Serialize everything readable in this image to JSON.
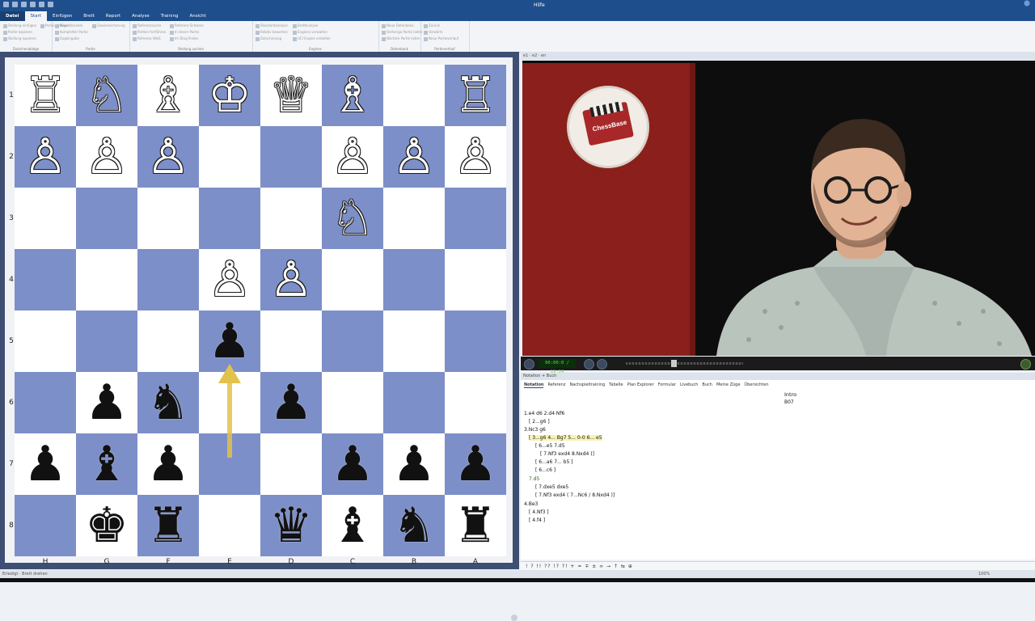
{
  "window": {
    "title": "Hilfe"
  },
  "menu": {
    "tabs": [
      "Datei",
      "Start",
      "Einfügen",
      "Brett",
      "Report",
      "Analyse",
      "Training",
      "Ansicht"
    ],
    "active": "Start"
  },
  "ribbon": {
    "groups": [
      {
        "name": "Zwischenablage",
        "items": [
          "Stellung einfügen",
          "Partie kopieren",
          "Stellung kopieren",
          "Partie einfügen"
        ]
      },
      {
        "name": "Partie",
        "items": [
          "Neue Variante",
          "Kompletter Partie",
          "Zugeingabe",
          "Gewinnsicherung"
        ]
      },
      {
        "name": "Stellung suchen",
        "items": [
          "Referenzsuche",
          "Partien fortführen",
          "Referenz Weiß",
          "Referenz Schwarz",
          "In dieser Partie",
          "Im Ding finden"
        ]
      },
      {
        "name": "Engines",
        "items": [
          "Standardanalyse",
          "Relativ bewerten",
          "Zwischenzug",
          "Brettanalyse",
          "Engines verwalten",
          "UCI Engine erstellen"
        ]
      },
      {
        "name": "Datenbank",
        "items": [
          "Neue Datenbank",
          "Vorherige Partie laden",
          "Nächste Partie laden"
        ]
      },
      {
        "name": "Partieverlauf",
        "items": [
          "Zurück",
          "Vorwärts",
          "Neue Partieverlauf"
        ]
      }
    ]
  },
  "board": {
    "files": [
      "H",
      "G",
      "F",
      "E",
      "D",
      "C",
      "B",
      "A"
    ],
    "ranks": [
      "1",
      "2",
      "3",
      "4",
      "5",
      "6",
      "7",
      "8"
    ],
    "squares": [
      [
        "R",
        "N",
        "B",
        "K",
        "Q",
        "B",
        "",
        "R"
      ],
      [
        "P",
        "P",
        "P",
        "",
        "",
        "P",
        "P",
        "P"
      ],
      [
        "",
        "",
        "",
        "",
        "",
        "N",
        "",
        ""
      ],
      [
        "",
        "",
        "",
        "P",
        "P",
        "",
        "",
        ""
      ],
      [
        "",
        "",
        "",
        "p",
        "",
        "",
        "",
        ""
      ],
      [
        "",
        "p",
        "n",
        "",
        "p",
        "",
        "",
        ""
      ],
      [
        "p",
        "b",
        "p",
        "",
        "",
        "p",
        "p",
        "p"
      ],
      [
        "",
        "k",
        "r",
        "",
        "q",
        "b",
        "n",
        "r"
      ]
    ],
    "arrow": {
      "from": "E7",
      "to": "E5",
      "color": "#e2c24a"
    }
  },
  "video": {
    "panel_title": "e1 · e2 · en",
    "logo_text": "ChessBase",
    "time": "00:00:0 / 19:54"
  },
  "notation": {
    "panel_title": "Notation + Buch",
    "tabs": [
      "Notation",
      "Referenz",
      "Nachspieltraining",
      "Tabelle",
      "Plan Explorer",
      "Formular",
      "Livebuch",
      "Buch",
      "Meine Züge",
      "Übersichten"
    ],
    "heading": "Intro",
    "eco": "B07",
    "lines": [
      "1.e4  d6  2.d4  Nf6",
      "[ 2...g6 ]",
      "3.Nc3  g6",
      "[ 3...g6  4... Bg7  5... 0-0  6... e5",
      "[ 6...e5  7.d5",
      "[ 7.Nf3  exd4  8.Nxd4 )]",
      "[ 6...a6  7... b5 ]",
      "[ 6...c6 ]",
      "7.d5",
      "[ 7.dxe5  dxe5",
      "[ 7.Nf3  exd4  ( 7...Nc6 / 8.Nxd4 )]",
      "4.Be3",
      "[ 4.Nf3 ]",
      "[ 4.f4 ]"
    ],
    "symbols": "! ? !! ?? !? ?! + = ∓ ± ∞ → ↑ ⇆ ⊕"
  },
  "status": {
    "left": "Erledigt · Brett drehen",
    "zoom": "100%"
  },
  "colors": {
    "accent": "#1f4e8c",
    "board_dark": "#7d8fc8",
    "board_light": "#ffffff",
    "frame": "#3f4f73"
  }
}
